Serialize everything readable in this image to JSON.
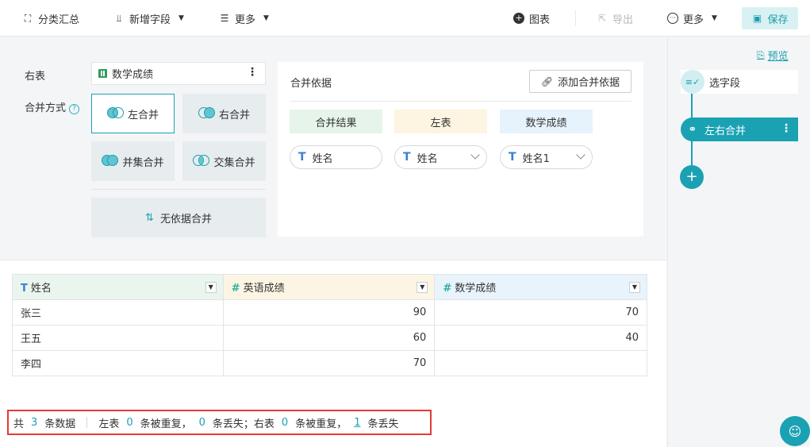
{
  "toolbar": {
    "group_summary": "分类汇总",
    "add_field": "新增字段",
    "more_left": "更多",
    "chart": "图表",
    "export": "导出",
    "more_right": "更多",
    "save": "保存"
  },
  "config": {
    "right_table_label": "右表",
    "right_table_value": "数学成绩",
    "merge_method_label": "合并方式",
    "options": [
      "左合并",
      "右合并",
      "并集合并",
      "交集合并"
    ],
    "selected_option": "左合并",
    "no_basis": "无依据合并"
  },
  "basis": {
    "title": "合并依据",
    "add_button": "添加合并依据",
    "headers": {
      "result": "合并结果",
      "left": "左表",
      "right": "数学成绩"
    },
    "fields": {
      "result": "姓名",
      "left": "姓名",
      "right": "姓名1"
    }
  },
  "table": {
    "columns": [
      {
        "type": "T",
        "name": "姓名"
      },
      {
        "type": "#",
        "name": "英语成绩"
      },
      {
        "type": "#",
        "name": "数学成绩"
      }
    ],
    "rows": [
      [
        "张三",
        "90",
        "70"
      ],
      [
        "王五",
        "60",
        "40"
      ],
      [
        "李四",
        "70",
        ""
      ]
    ]
  },
  "summary": {
    "total_prefix": "共",
    "total": "3",
    "total_suffix": "条数据",
    "left_label": "左表",
    "left_dup": "0",
    "dup_text": "条被重复，",
    "left_lost": "0",
    "lost_text_left": "条丢失；右表",
    "right_dup": "0",
    "dup_text_right": "条被重复，",
    "right_lost": "1",
    "lost_text_right": "条丢失"
  },
  "flow": {
    "preview": "预览",
    "step1": "选字段",
    "step2": "左右合并"
  },
  "colors": {
    "accent": "#1aa2b3",
    "highlight": "#e53935"
  }
}
